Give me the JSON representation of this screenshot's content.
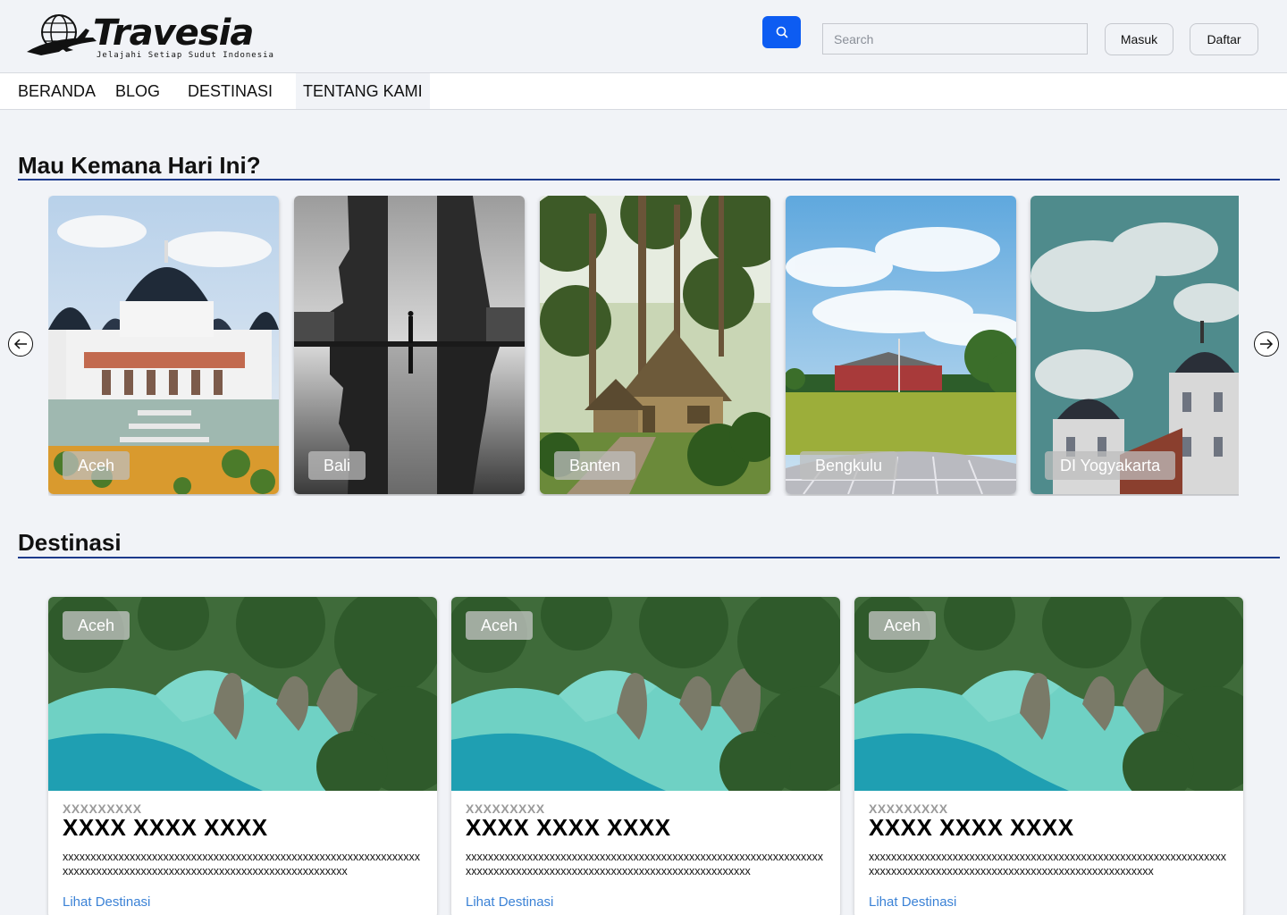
{
  "header": {
    "brand_name": "Travesia",
    "tagline": "Jelajahi Setiap Sudut Indonesia",
    "search_placeholder": "Search",
    "login_label": "Masuk",
    "register_label": "Daftar"
  },
  "nav": {
    "items": [
      {
        "label": "BERANDA"
      },
      {
        "label": "BLOG"
      },
      {
        "label": "DESTINASI"
      },
      {
        "label": "TENTANG KAMI"
      }
    ]
  },
  "provinces": {
    "title": "Mau Kemana Hari Ini?",
    "items": [
      {
        "label": "Aceh"
      },
      {
        "label": "Bali"
      },
      {
        "label": "Banten"
      },
      {
        "label": "Bengkulu"
      },
      {
        "label": "DI Yogyakarta"
      }
    ]
  },
  "destinations": {
    "title": "Destinasi",
    "cards": [
      {
        "badge": "Aceh",
        "subtitle": "XXXXXXXXX",
        "title": "XXXX XXXX XXXX",
        "body": "xxxxxxxxxxxxxxxxxxxxxxxxxxxxxxxxxxxxxxxxxxxxxxxxxxxxxxxxxxxxxxxxxxxxxxxxxxxxxxxxxxxxxxxxxxxxxxxxxxxxxxxxxxxxxxxxxxx",
        "link": "Lihat Destinasi"
      },
      {
        "badge": "Aceh",
        "subtitle": "XXXXXXXXX",
        "title": "XXXX XXXX XXXX",
        "body": "xxxxxxxxxxxxxxxxxxxxxxxxxxxxxxxxxxxxxxxxxxxxxxxxxxxxxxxxxxxxxxxxxxxxxxxxxxxxxxxxxxxxxxxxxxxxxxxxxxxxxxxxxxxxxxxxxxx",
        "link": "Lihat Destinasi"
      },
      {
        "badge": "Aceh",
        "subtitle": "XXXXXXXXX",
        "title": "XXXX XXXX XXXX",
        "body": "xxxxxxxxxxxxxxxxxxxxxxxxxxxxxxxxxxxxxxxxxxxxxxxxxxxxxxxxxxxxxxxxxxxxxxxxxxxxxxxxxxxxxxxxxxxxxxxxxxxxxxxxxxxxxxxxxxx",
        "link": "Lihat Destinasi"
      }
    ]
  },
  "colors": {
    "accent": "#0d5cf2",
    "section_rule": "#1c3a8c",
    "link": "#3b82d6"
  },
  "icons": {
    "search": "search-icon",
    "prev": "arrow-left-circle-icon",
    "next": "arrow-right-circle-icon"
  }
}
